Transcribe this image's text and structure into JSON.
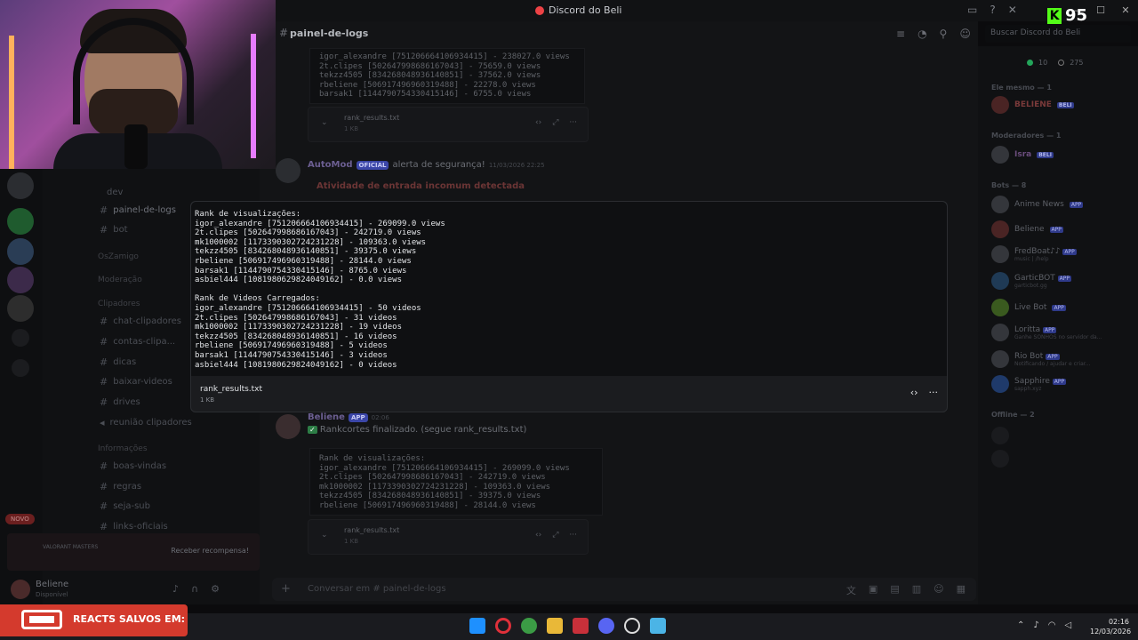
{
  "window": {
    "title": "Discord do Beli",
    "kick_viewers": "95"
  },
  "header": {
    "channel": "painel-de-logs",
    "search_placeholder": "Buscar Discord do Beli"
  },
  "sidebar": {
    "categories": [
      "OsZamigo",
      "Moderação",
      "Clipadores",
      "Informações"
    ],
    "channels": [
      "dev",
      "painel-de-logs",
      "bot",
      "chat-clipadores",
      "contas-clipa...",
      "dicas",
      "baixar-videos",
      "drives",
      "reunião clipadores",
      "boas-vindas",
      "regras",
      "seja-sub",
      "links-oficiais"
    ],
    "novo_label": "NOVO",
    "promo_title": "VALORANT MASTERS",
    "promo_button": "Receber recompensa!"
  },
  "user": {
    "name": "Beliene",
    "status": "Disponível"
  },
  "chat": {
    "top_code_lines": [
      "igor_alexandre [751206664106934415] - 238027.0 views",
      "2t.clipes [502647998686167043] - 75659.0 views",
      "tekzz4505 [834268048936140851] - 37562.0 views",
      "rbeliene [506917496960319488] - 22278.0 views",
      "barsak1 [1144790754330415146] - 6755.0 views"
    ],
    "attachment_name": "rank_results.txt",
    "attachment_size": "1 KB",
    "automod_author": "AutoMod",
    "automod_badge": "OFICIAL",
    "automod_text": "alerta de segurança!",
    "automod_time": "11/03/2026 22:25",
    "automod_alert": "Atividade de entrada incomum detectada",
    "bot_author": "Beliene",
    "bot_badge": "APP",
    "bot_time": "02:06",
    "bot_message": "Rankcortes finalizado. (segue rank_results.txt)",
    "bottom_code_lines": [
      "Rank de visualizações:",
      "igor_alexandre [751206664106934415] - 269099.0 views",
      "2t.clipes [502647998686167043] - 242719.0 views",
      "mk1000002 [1173390302724231228] - 109363.0 views",
      "tekzz4505 [834268048936140851] - 39375.0 views",
      "rbeliene [506917496960319488] - 28144.0 views"
    ],
    "composer_placeholder": "Conversar em # painel-de-logs"
  },
  "modal": {
    "lines": [
      "Rank de visualizações:",
      "igor_alexandre [751206664106934415] - 269099.0 views",
      "2t.clipes [502647998686167043] - 242719.0 views",
      "mk1000002 [1173390302724231228] - 109363.0 views",
      "tekzz4505 [834268048936140851] - 39375.0 views",
      "rbeliene [506917496960319488] - 28144.0 views",
      "barsak1 [1144790754330415146] - 8765.0 views",
      "asbiel444 [1081980629824049162] - 0.0 views",
      "",
      "Rank de Videos Carregados:",
      "igor_alexandre [751206664106934415] - 50 videos",
      "2t.clipes [502647998686167043] - 31 videos",
      "mk1000002 [1173390302724231228] - 19 videos",
      "tekzz4505 [834268048936140851] - 16 videos",
      "rbeliene [506917496960319488] - 5 videos",
      "barsak1 [1144790754330415146] - 3 videos",
      "asbiel444 [1081980629824049162] - 0 videos"
    ],
    "file_name": "rank_results.txt",
    "file_size": "1 KB"
  },
  "members": {
    "online_count": "10",
    "total_count": "275",
    "categories": [
      "Ele mesmo — 1",
      "Moderadores — 1",
      "Bots — 8",
      "Offline — 2"
    ],
    "list": [
      {
        "name": "BELIENE",
        "tag": "BELI",
        "sub": ""
      },
      {
        "name": "Isra",
        "tag": "BELI",
        "sub": ""
      },
      {
        "name": "Anime News",
        "tag": "APP",
        "sub": ""
      },
      {
        "name": "Beliene",
        "tag": "APP",
        "sub": ""
      },
      {
        "name": "FredBoat♪♪",
        "tag": "APP",
        "sub": "music | /help"
      },
      {
        "name": "GarticBOT",
        "tag": "APP",
        "sub": "garticbot.gg"
      },
      {
        "name": "Live Bot",
        "tag": "APP",
        "sub": ""
      },
      {
        "name": "Loritta",
        "tag": "APP",
        "sub": "Ganhe SONHOS no servidor da..."
      },
      {
        "name": "Rio Bot",
        "tag": "APP",
        "sub": "Notificando / ajudar e criar..."
      },
      {
        "name": "Sapphire",
        "tag": "APP",
        "sub": "sapph.xyz"
      }
    ]
  },
  "overlay": {
    "reacts_text": "REACTS SALVOS EM:"
  },
  "taskbar": {
    "time": "02:16",
    "date": "12/03/2026"
  }
}
